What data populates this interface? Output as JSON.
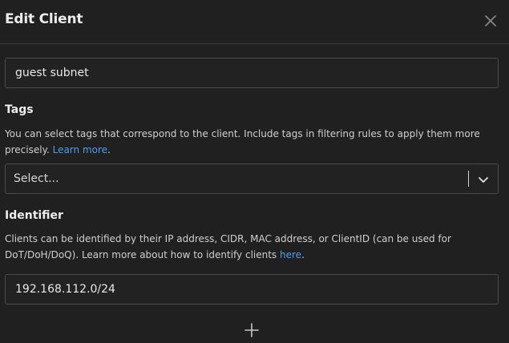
{
  "dialog": {
    "title": "Edit Client"
  },
  "name_field": {
    "value": "guest subnet"
  },
  "tags": {
    "label": "Tags",
    "description": "You can select tags that correspond to the client. Include tags in filtering rules to apply them more precisely. ",
    "link_text": "Learn more",
    "after_link": ".",
    "select_placeholder": "Select..."
  },
  "identifier": {
    "label": "Identifier",
    "description": "Clients can be identified by their IP address, CIDR, MAC address, or ClientID (can be used for DoT/DoH/DoQ). Learn more about how to identify clients ",
    "link_text": "here",
    "after_link": ".",
    "value": "192.168.112.0/24"
  },
  "icons": {
    "close": "close-icon",
    "dropdown": "chevron-down-icon",
    "add": "plus-icon"
  }
}
